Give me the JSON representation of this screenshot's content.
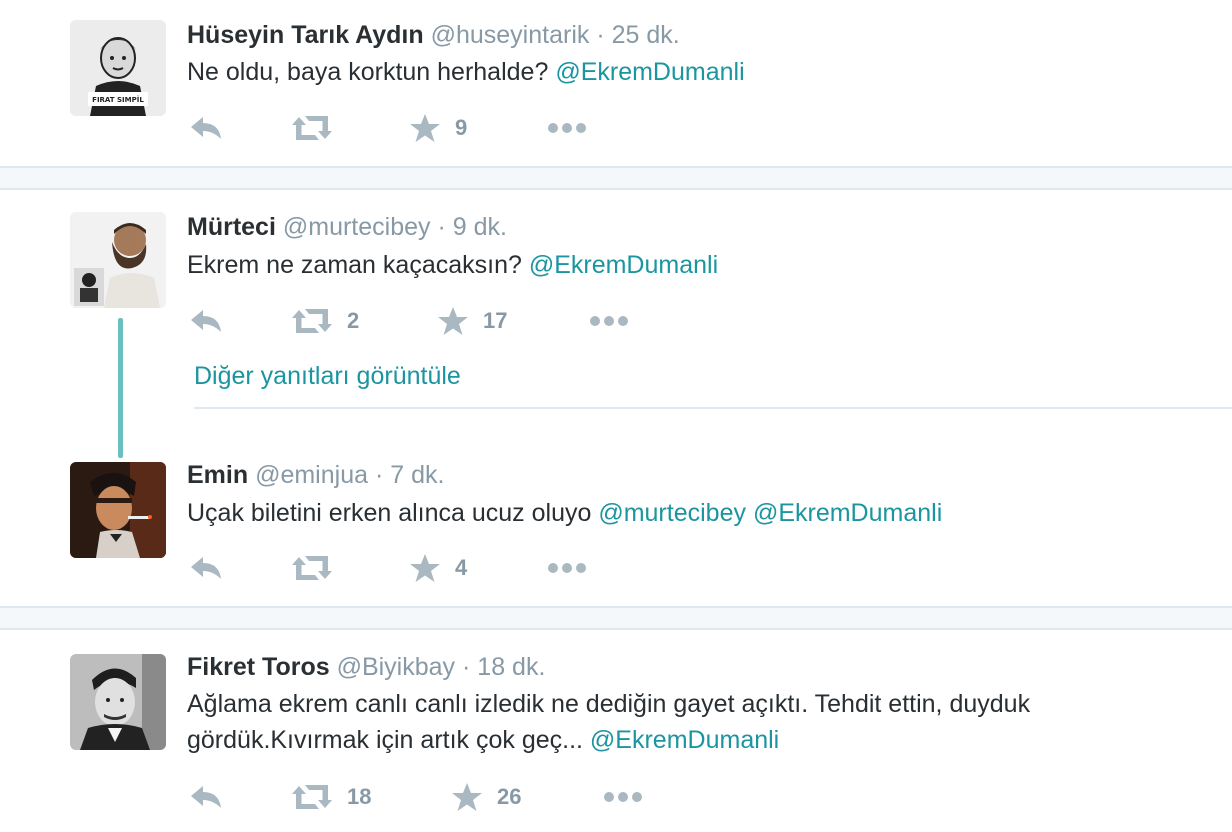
{
  "tweets": [
    {
      "name": "Hüseyin Tarık Aydın",
      "handle": "@huseyintarik",
      "time": "25 dk.",
      "text_parts": [
        "Ne oldu, baya korktun herhalde? "
      ],
      "mentions": [
        "@EkremDumanli"
      ],
      "avatar_caption": "FIRAT SIMPİL",
      "retweets": "",
      "likes": "9"
    },
    {
      "name": "Mürteci",
      "handle": "@murtecibey",
      "time": "9 dk.",
      "text_parts": [
        "Ekrem ne zaman kaçacaksın? "
      ],
      "mentions": [
        "@EkremDumanli"
      ],
      "retweets": "2",
      "likes": "17"
    },
    {
      "name": "Emin",
      "handle": "@eminjua",
      "time": "7 dk.",
      "text_parts": [
        "Uçak biletini erken alınca ucuz oluyo "
      ],
      "mentions": [
        "@murtecibey",
        "@EkremDumanli"
      ],
      "retweets": "",
      "likes": "4"
    },
    {
      "name": "Fikret Toros",
      "handle": "@Biyikbay",
      "time": "18 dk.",
      "text_line1": "Ağlama ekrem canlı canlı izledik ne dediğin gayet açıktı. Tehdit ettin, duyduk",
      "text_line2": "gördük.Kıvırmak için artık çok geç... ",
      "mentions": [
        "@EkremDumanli"
      ],
      "retweets": "18",
      "likes": "26"
    }
  ],
  "separator_dot": "·",
  "more_replies_label": "Diğer yanıtları görüntüle",
  "icons": {
    "reply": "reply-icon",
    "retweet": "retweet-icon",
    "like": "star-icon",
    "more": "more-icon"
  },
  "colors": {
    "text": "#292f33",
    "muted": "#8899a6",
    "icon": "#aab8c2",
    "link": "#1b95a0",
    "thread_line": "#6ac0c0",
    "separator_bg": "#f5f8fa"
  }
}
